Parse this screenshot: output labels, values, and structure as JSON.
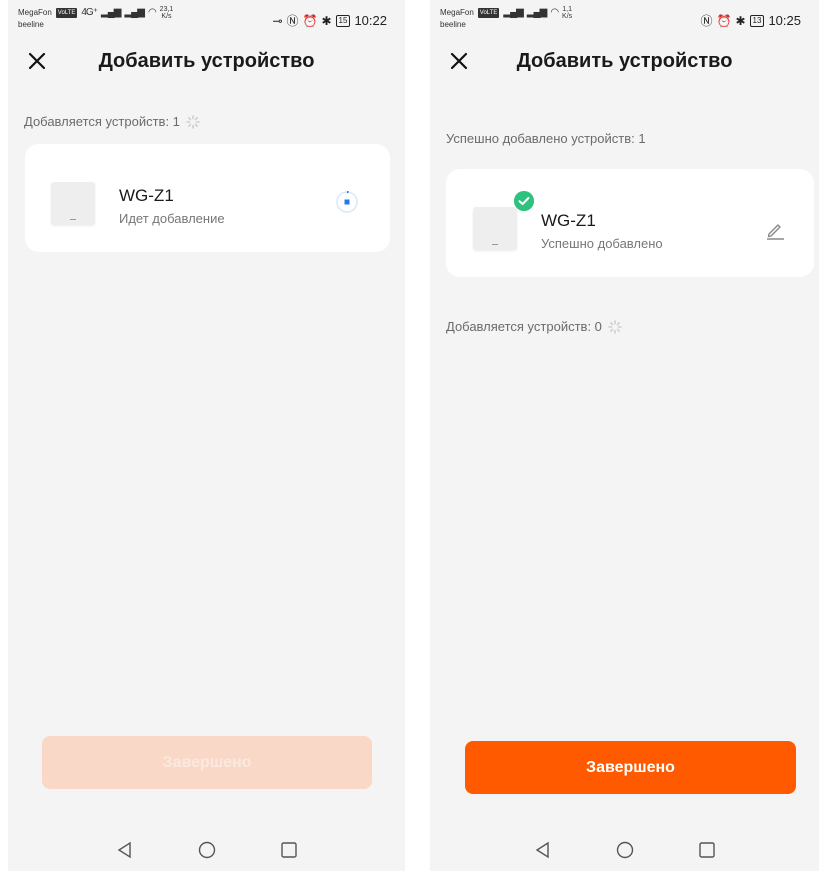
{
  "left": {
    "status": {
      "carrier1": "MegaFon",
      "carrier2": "beeline",
      "volte": "VoLTE",
      "net": "4G⁺",
      "speed_value": "23,1",
      "speed_unit": "K/s",
      "battery": "15",
      "time": "10:22"
    },
    "title": "Добавить устройство",
    "adding_label": "Добавляется устройств: 1",
    "device": {
      "name": "WG-Z1",
      "status": "Идет добавление"
    },
    "done_button": "Завершено"
  },
  "right": {
    "status": {
      "carrier1": "MegaFon",
      "carrier2": "beeline",
      "volte": "VoLTE",
      "speed_value": "1,1",
      "speed_unit": "K/s",
      "battery": "13",
      "time": "10:25"
    },
    "title": "Добавить устройство",
    "success_label": "Успешно добавлено устройств: 1",
    "device": {
      "name": "WG-Z1",
      "status": "Успешно добавлено"
    },
    "adding_label": "Добавляется устройств: 0",
    "done_button": "Завершено"
  },
  "colors": {
    "accent": "#ff5a00",
    "accent_disabled": "#f9d8c7",
    "success": "#2ec27e",
    "progress": "#1e7bf2"
  },
  "icons": [
    "close-icon",
    "spinner-icon",
    "progress-icon",
    "check-icon",
    "edit-icon",
    "back-icon",
    "home-icon",
    "recents-icon"
  ]
}
